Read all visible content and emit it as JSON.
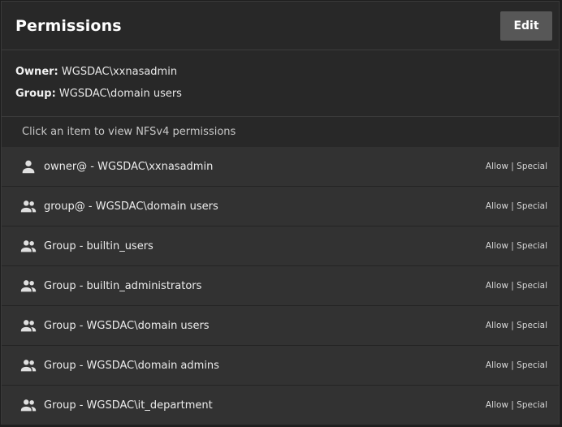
{
  "header": {
    "title": "Permissions",
    "edit_label": "Edit"
  },
  "owner": {
    "label": "Owner:",
    "value": "WGSDAC\\xxnasadmin"
  },
  "group": {
    "label": "Group:",
    "value": "WGSDAC\\domain users"
  },
  "hint": "Click an item to view NFSv4 permissions",
  "items": [
    {
      "icon": "person-icon",
      "label": "owner@ - WGSDAC\\xxnasadmin",
      "status": "Allow | Special"
    },
    {
      "icon": "people-icon",
      "label": "group@ - WGSDAC\\domain users",
      "status": "Allow | Special"
    },
    {
      "icon": "people-icon",
      "label": "Group - builtin_users",
      "status": "Allow | Special"
    },
    {
      "icon": "people-icon",
      "label": "Group - builtin_administrators",
      "status": "Allow | Special"
    },
    {
      "icon": "people-icon",
      "label": "Group - WGSDAC\\domain users",
      "status": "Allow | Special"
    },
    {
      "icon": "people-icon",
      "label": "Group - WGSDAC\\domain admins",
      "status": "Allow | Special"
    },
    {
      "icon": "people-icon",
      "label": "Group - WGSDAC\\it_department",
      "status": "Allow | Special"
    }
  ]
}
